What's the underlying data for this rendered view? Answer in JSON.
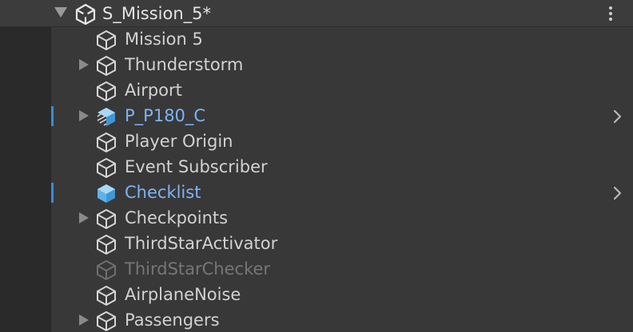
{
  "scene": {
    "title": "S_Mission_5*",
    "icon": "unity-logo-icon",
    "menu_icon": "kebab-menu-icon"
  },
  "colors": {
    "background": "#383838",
    "gutter": "#2a2a2a",
    "text": "#d2d2d2",
    "prefab_text": "#7fb3f5",
    "inactive_text": "#767676",
    "selection_marker": "#3a8dd2"
  },
  "hierarchy": {
    "items": [
      {
        "label": "Mission 5",
        "icon": "gameobject-icon",
        "expandable": false,
        "prefab": false,
        "inactive": false,
        "marker": false,
        "chevron": false
      },
      {
        "label": "Thunderstorm",
        "icon": "gameobject-icon",
        "expandable": true,
        "prefab": false,
        "inactive": false,
        "marker": false,
        "chevron": false
      },
      {
        "label": "Airport",
        "icon": "gameobject-icon",
        "expandable": false,
        "prefab": false,
        "inactive": false,
        "marker": false,
        "chevron": false
      },
      {
        "label": "P_P180_C",
        "icon": "prefab-variant-icon",
        "expandable": true,
        "prefab": true,
        "inactive": false,
        "marker": true,
        "chevron": true
      },
      {
        "label": "Player Origin",
        "icon": "gameobject-icon",
        "expandable": false,
        "prefab": false,
        "inactive": false,
        "marker": false,
        "chevron": false
      },
      {
        "label": "Event Subscriber",
        "icon": "gameobject-icon",
        "expandable": false,
        "prefab": false,
        "inactive": false,
        "marker": false,
        "chevron": false
      },
      {
        "label": "Checklist",
        "icon": "prefab-icon",
        "expandable": false,
        "prefab": true,
        "inactive": false,
        "marker": true,
        "chevron": true
      },
      {
        "label": "Checkpoints",
        "icon": "gameobject-icon",
        "expandable": true,
        "prefab": false,
        "inactive": false,
        "marker": false,
        "chevron": false
      },
      {
        "label": "ThirdStarActivator",
        "icon": "gameobject-icon",
        "expandable": false,
        "prefab": false,
        "inactive": false,
        "marker": false,
        "chevron": false
      },
      {
        "label": "ThirdStarChecker",
        "icon": "gameobject-icon",
        "expandable": false,
        "prefab": false,
        "inactive": true,
        "marker": false,
        "chevron": false
      },
      {
        "label": "AirplaneNoise",
        "icon": "gameobject-icon",
        "expandable": false,
        "prefab": false,
        "inactive": false,
        "marker": false,
        "chevron": false
      },
      {
        "label": "Passengers",
        "icon": "gameobject-icon",
        "expandable": true,
        "prefab": false,
        "inactive": false,
        "marker": false,
        "chevron": false
      }
    ]
  }
}
